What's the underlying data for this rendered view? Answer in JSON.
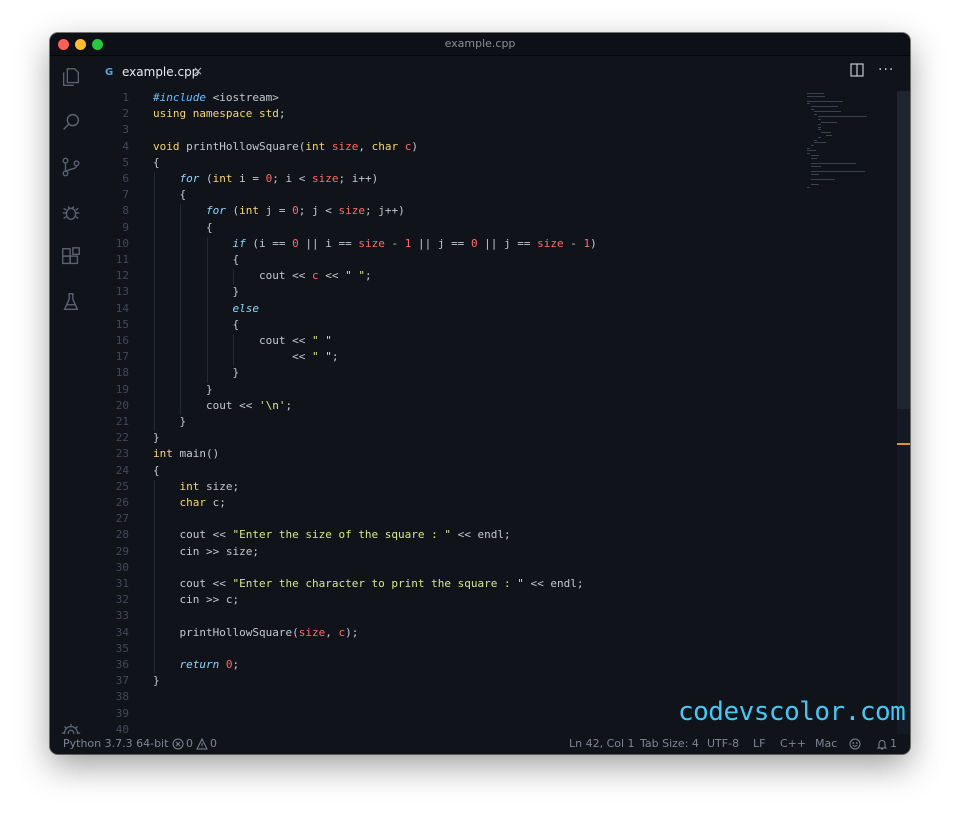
{
  "window": {
    "title": "example.cpp"
  },
  "tabs": [
    {
      "label": "example.cpp",
      "icon": "c++-file-icon",
      "close_glyph": "×"
    }
  ],
  "activity_bar": [
    "explorer-icon",
    "search-icon",
    "source-control-icon",
    "debug-icon",
    "extensions-icon",
    "testing-icon",
    "settings-gear-icon"
  ],
  "editor": {
    "line_numbers": [
      "1",
      "2",
      "3",
      "4",
      "5",
      "6",
      "7",
      "8",
      "9",
      "10",
      "11",
      "12",
      "13",
      "14",
      "15",
      "16",
      "17",
      "18",
      "19",
      "20",
      "21",
      "22",
      "23",
      "24",
      "25",
      "26",
      "27",
      "28",
      "29",
      "30",
      "31",
      "32",
      "33",
      "34",
      "35",
      "36",
      "37",
      "38",
      "39",
      "40"
    ],
    "lines": [
      "#include <iostream>",
      "using namespace std;",
      "",
      "void printHollowSquare(int size, char c)",
      "{",
      "    for (int i = 0; i < size; i++)",
      "    {",
      "        for (int j = 0; j < size; j++)",
      "        {",
      "            if (i == 0 || i == size - 1 || j == 0 || j == size - 1)",
      "            {",
      "                cout << c << \" \";",
      "            }",
      "            else",
      "            {",
      "                cout << \" \"",
      "                     << \" \";",
      "            }",
      "        }",
      "        cout << '\\n';",
      "    }",
      "}",
      "int main()",
      "{",
      "    int size;",
      "    char c;",
      "",
      "    cout << \"Enter the size of the square : \" << endl;",
      "    cin >> size;",
      "",
      "    cout << \"Enter the character to print the square : \" << endl;",
      "    cin >> c;",
      "",
      "    printHollowSquare(size, c);",
      "",
      "    return 0;",
      "}",
      "",
      "",
      ""
    ]
  },
  "watermark": "codevscolor.com",
  "status_bar": {
    "interpreter": "Python 3.7.3 64-bit",
    "errors": "0",
    "warnings": "0",
    "cursor": "Ln 42, Col 1",
    "tab_size": "Tab Size: 4",
    "encoding": "UTF-8",
    "eol": "LF",
    "language": "C++",
    "platform": "Mac",
    "notifications": "1"
  },
  "colors": {
    "background": "#10131a",
    "keyword": "#8ed8ff",
    "type_keyword": "#f5d576",
    "number": "#ff6b6b",
    "string": "#d6e88a",
    "accent": "#39b7d8",
    "watermark": "#45c8f3"
  }
}
